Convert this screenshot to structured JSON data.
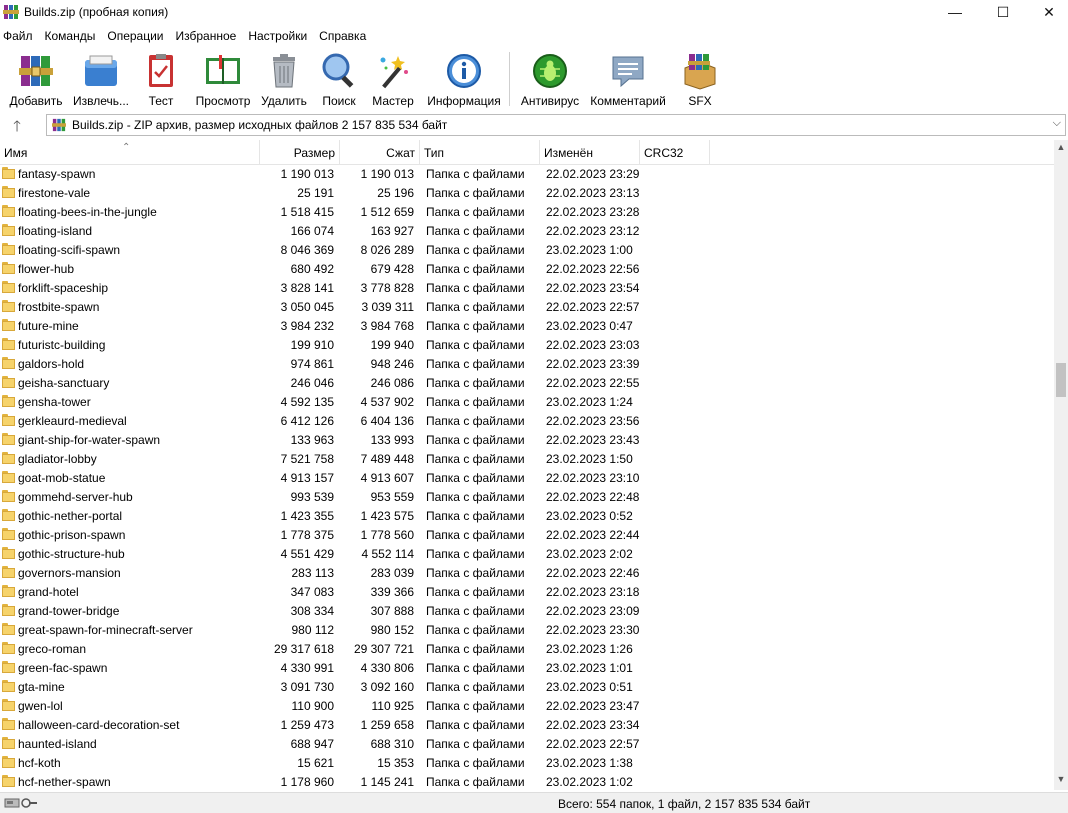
{
  "window": {
    "title": "Builds.zip (пробная копия)",
    "minimize_glyph": "—",
    "maximize_glyph": "☐",
    "close_glyph": "✕"
  },
  "menu": [
    "Файл",
    "Команды",
    "Операции",
    "Избранное",
    "Настройки",
    "Справка"
  ],
  "toolbar": {
    "buttons": [
      {
        "label": "Добавить",
        "icon": "add-archive-icon"
      },
      {
        "label": "Извлечь...",
        "icon": "extract-icon"
      },
      {
        "label": "Тест",
        "icon": "test-icon"
      },
      {
        "label": "Просмотр",
        "icon": "view-icon"
      },
      {
        "label": "Удалить",
        "icon": "delete-icon"
      },
      {
        "label": "Поиск",
        "icon": "find-icon"
      },
      {
        "label": "Мастер",
        "icon": "wizard-icon"
      },
      {
        "label": "Информация",
        "icon": "info-icon"
      },
      {
        "label": "Антивирус",
        "icon": "antivirus-icon"
      },
      {
        "label": "Комментарий",
        "icon": "comment-icon"
      },
      {
        "label": "SFX",
        "icon": "sfx-icon"
      }
    ]
  },
  "address": {
    "text": "Builds.zip - ZIP архив, размер исходных файлов 2 157 835 534 байт",
    "up_glyph": "🡑",
    "dropdown_glyph": "⌵"
  },
  "columns": {
    "name": "Имя",
    "size": "Размер",
    "packed": "Сжат",
    "type": "Тип",
    "modified": "Изменён",
    "crc": "CRC32",
    "sort_glyph": "⌃"
  },
  "files": [
    {
      "name": "fantasy-spawn",
      "size": "1 190 013",
      "packed": "1 190 013",
      "type": "Папка с файлами",
      "modified": "22.02.2023 23:29"
    },
    {
      "name": "firestone-vale",
      "size": "25 191",
      "packed": "25 196",
      "type": "Папка с файлами",
      "modified": "22.02.2023 23:13"
    },
    {
      "name": "floating-bees-in-the-jungle",
      "size": "1 518 415",
      "packed": "1 512 659",
      "type": "Папка с файлами",
      "modified": "22.02.2023 23:28"
    },
    {
      "name": "floating-island",
      "size": "166 074",
      "packed": "163 927",
      "type": "Папка с файлами",
      "modified": "22.02.2023 23:12"
    },
    {
      "name": "floating-scifi-spawn",
      "size": "8 046 369",
      "packed": "8 026 289",
      "type": "Папка с файлами",
      "modified": "23.02.2023 1:00"
    },
    {
      "name": "flower-hub",
      "size": "680 492",
      "packed": "679 428",
      "type": "Папка с файлами",
      "modified": "22.02.2023 22:56"
    },
    {
      "name": "forklift-spaceship",
      "size": "3 828 141",
      "packed": "3 778 828",
      "type": "Папка с файлами",
      "modified": "22.02.2023 23:54"
    },
    {
      "name": "frostbite-spawn",
      "size": "3 050 045",
      "packed": "3 039 311",
      "type": "Папка с файлами",
      "modified": "22.02.2023 22:57"
    },
    {
      "name": "future-mine",
      "size": "3 984 232",
      "packed": "3 984 768",
      "type": "Папка с файлами",
      "modified": "23.02.2023 0:47"
    },
    {
      "name": "futuristc-building",
      "size": "199 910",
      "packed": "199 940",
      "type": "Папка с файлами",
      "modified": "22.02.2023 23:03"
    },
    {
      "name": "galdors-hold",
      "size": "974 861",
      "packed": "948 246",
      "type": "Папка с файлами",
      "modified": "22.02.2023 23:39"
    },
    {
      "name": "geisha-sanctuary",
      "size": "246 046",
      "packed": "246 086",
      "type": "Папка с файлами",
      "modified": "22.02.2023 22:55"
    },
    {
      "name": "gensha-tower",
      "size": "4 592 135",
      "packed": "4 537 902",
      "type": "Папка с файлами",
      "modified": "23.02.2023 1:24"
    },
    {
      "name": "gerkleaurd-medieval",
      "size": "6 412 126",
      "packed": "6 404 136",
      "type": "Папка с файлами",
      "modified": "22.02.2023 23:56"
    },
    {
      "name": "giant-ship-for-water-spawn",
      "size": "133 963",
      "packed": "133 993",
      "type": "Папка с файлами",
      "modified": "22.02.2023 23:43"
    },
    {
      "name": "gladiator-lobby",
      "size": "7 521 758",
      "packed": "7 489 448",
      "type": "Папка с файлами",
      "modified": "23.02.2023 1:50"
    },
    {
      "name": "goat-mob-statue",
      "size": "4 913 157",
      "packed": "4 913 607",
      "type": "Папка с файлами",
      "modified": "22.02.2023 23:10"
    },
    {
      "name": "gommehd-server-hub",
      "size": "993 539",
      "packed": "953 559",
      "type": "Папка с файлами",
      "modified": "22.02.2023 22:48"
    },
    {
      "name": "gothic-nether-portal",
      "size": "1 423 355",
      "packed": "1 423 575",
      "type": "Папка с файлами",
      "modified": "23.02.2023 0:52"
    },
    {
      "name": "gothic-prison-spawn",
      "size": "1 778 375",
      "packed": "1 778 560",
      "type": "Папка с файлами",
      "modified": "22.02.2023 22:44"
    },
    {
      "name": "gothic-structure-hub",
      "size": "4 551 429",
      "packed": "4 552 114",
      "type": "Папка с файлами",
      "modified": "23.02.2023 2:02"
    },
    {
      "name": "governors-mansion",
      "size": "283 113",
      "packed": "283 039",
      "type": "Папка с файлами",
      "modified": "22.02.2023 22:46"
    },
    {
      "name": "grand-hotel",
      "size": "347 083",
      "packed": "339 366",
      "type": "Папка с файлами",
      "modified": "22.02.2023 23:18"
    },
    {
      "name": "grand-tower-bridge",
      "size": "308 334",
      "packed": "307 888",
      "type": "Папка с файлами",
      "modified": "22.02.2023 23:09"
    },
    {
      "name": "great-spawn-for-minecraft-server",
      "size": "980 112",
      "packed": "980 152",
      "type": "Папка с файлами",
      "modified": "22.02.2023 23:30"
    },
    {
      "name": "greco-roman",
      "size": "29 317 618",
      "packed": "29 307 721",
      "type": "Папка с файлами",
      "modified": "23.02.2023 1:26"
    },
    {
      "name": "green-fac-spawn",
      "size": "4 330 991",
      "packed": "4 330 806",
      "type": "Папка с файлами",
      "modified": "23.02.2023 1:01"
    },
    {
      "name": "gta-mine",
      "size": "3 091 730",
      "packed": "3 092 160",
      "type": "Папка с файлами",
      "modified": "23.02.2023 0:51"
    },
    {
      "name": "gwen-lol",
      "size": "110 900",
      "packed": "110 925",
      "type": "Папка с файлами",
      "modified": "22.02.2023 23:47"
    },
    {
      "name": "halloween-card-decoration-set",
      "size": "1 259 473",
      "packed": "1 259 658",
      "type": "Папка с файлами",
      "modified": "22.02.2023 23:34"
    },
    {
      "name": "haunted-island",
      "size": "688 947",
      "packed": "688 310",
      "type": "Папка с файлами",
      "modified": "22.02.2023 22:57"
    },
    {
      "name": "hcf-koth",
      "size": "15 621",
      "packed": "15 353",
      "type": "Папка с файлами",
      "modified": "23.02.2023 1:38"
    },
    {
      "name": "hcf-nether-spawn",
      "size": "1 178 960",
      "packed": "1 145 241",
      "type": "Папка с файлами",
      "modified": "23.02.2023 1:02"
    }
  ],
  "scrollbar": {
    "up_glyph": "▲",
    "down_glyph": "▼"
  },
  "status": {
    "text": "Всего: 554 папок, 1 файл, 2 157 835 534 байт"
  },
  "colors": {
    "folder": "#f6d36b",
    "folder_border": "#d8a83a",
    "separator": "#cfcfcf"
  }
}
